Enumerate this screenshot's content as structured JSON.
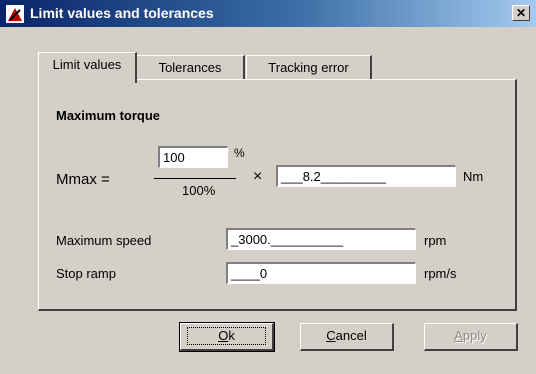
{
  "window": {
    "title": "Limit values and tolerances",
    "close_glyph": "✕"
  },
  "tabs": [
    {
      "label": "Limit values",
      "active": true
    },
    {
      "label": "Tolerances",
      "active": false
    },
    {
      "label": "Tracking error",
      "active": false
    }
  ],
  "limit_values": {
    "section_title": "Maximum torque",
    "mmax_label": "Mmax  =",
    "percent_value": "100",
    "percent_unit": "%",
    "denominator": "100%",
    "times_sign": "×",
    "torque_value": "___8.2_________",
    "torque_unit": "Nm",
    "max_speed_label": "Maximum speed",
    "max_speed_value": "_3000.__________",
    "max_speed_unit": "rpm",
    "stop_ramp_label": "Stop ramp",
    "stop_ramp_value": "____0",
    "stop_ramp_unit": "rpm/s"
  },
  "buttons": {
    "ok_mnemonic": "O",
    "ok_rest": "k",
    "cancel_mnemonic": "C",
    "cancel_rest": "ancel",
    "apply_mnemonic": "A",
    "apply_rest": "pply"
  },
  "colors": {
    "dialog_face": "#d4d0c8",
    "title_start": "#0a246a",
    "title_end": "#a6caf0"
  },
  "icons": {
    "app_icon": "pencil-gauge-icon"
  }
}
